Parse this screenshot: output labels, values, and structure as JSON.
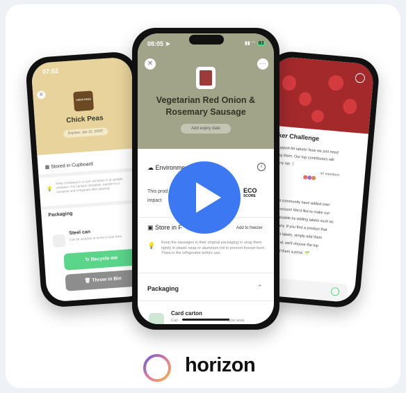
{
  "left_phone": {
    "time": "07:52",
    "product_title": "Chick Peas",
    "thumb_label": "CHICK PEAS",
    "expiry": "Expires: Jan 15, 2025*",
    "storage_label": "Stored in Cupboard",
    "storage_tip": "Keep chickpeas in a cool, dry place in an airtight container. For canned chickpeas, transfer to a container and refrigerate after opening.",
    "packaging_label": "Packaging",
    "item_name": "Steel can",
    "item_note": "Can be recycled at home in your area",
    "recycle_btn": "Recycle me",
    "bin_btn": "Throw in Bin",
    "colors": {
      "hero": "#e7d39b",
      "recycle": "#5bd58a",
      "bin": "#8d8d8d"
    }
  },
  "center_phone": {
    "time": "08:05",
    "battery": "83",
    "product_title": "Vegetarian Red Onion & Rosemary Sausage",
    "expiry_button": "Add expiry date",
    "impact_label": "Environmental impact",
    "impact_text_1": "This prod",
    "impact_text_2": "impact",
    "eco_score_line1": "ECO",
    "eco_score_line2": "SCORE",
    "store_label": "Store in F",
    "add_freezer": "Add to freezer",
    "storage_tip": "Keep the sausages in their original packaging or wrap them tightly in plastic wrap or aluminum foil to prevent freezer burn. Thaw in the refrigerator before use.",
    "packaging_label": "Packaging",
    "item_name": "Card carton",
    "item_note_start": "Can",
    "item_note_end": "your area",
    "colors": {
      "hero": "#a1a489"
    }
  },
  "right_phone": {
    "challenge_title": "aker Challenge",
    "intro_lines": [
      "d support for labels! Now we just need",
      "dding them. Our top contributors will",
      "cutlery set 🍴"
    ],
    "members": "42 members",
    "body_lines": [
      "nderful community have added over",
      "cts to horizon! We'd like to make our",
      "nore valuable by adding labels such as",
      "tains dairy. If you find a product that",
      "e correct labels, simply add them",
      "At the end, we'll choose the top",
      "nd award them a prize. 🌱"
    ],
    "colors": {
      "hero": "#a3292b"
    }
  },
  "video": {
    "accent": "#3b78f1"
  },
  "brand": {
    "name": "horizon"
  }
}
